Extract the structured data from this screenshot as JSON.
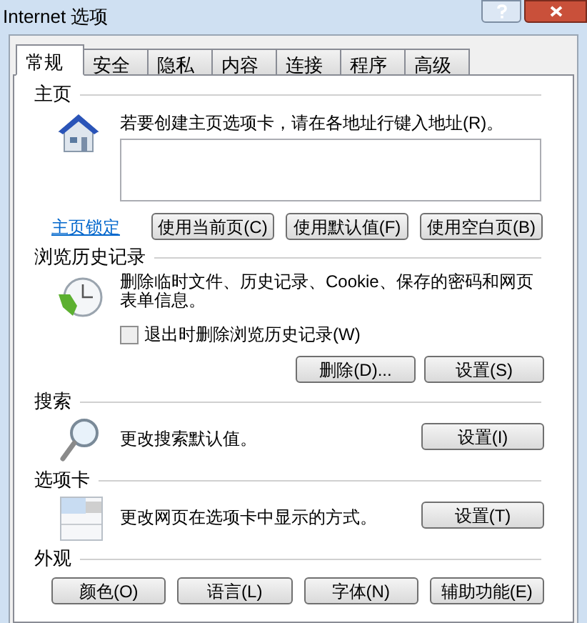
{
  "window": {
    "title": "Internet 选项"
  },
  "tabs": [
    {
      "label": "常规",
      "selected": true
    },
    {
      "label": "安全",
      "selected": false
    },
    {
      "label": "隐私",
      "selected": false
    },
    {
      "label": "内容",
      "selected": false
    },
    {
      "label": "连接",
      "selected": false
    },
    {
      "label": "程序",
      "selected": false
    },
    {
      "label": "高级",
      "selected": false
    }
  ],
  "sections": [
    {
      "kind": "home",
      "heading": "主页",
      "description": "若要创建主页选项卡，请在各地址行键入地址(R)。",
      "link": "主页锁定",
      "buttons": [
        "使用当前页(C)",
        "使用默认值(F)",
        "使用空白页(B)"
      ]
    },
    {
      "kind": "history",
      "heading": "浏览历史记录",
      "description": "删除临时文件、历史记录、Cookie、保存的密码和网页表单信息。",
      "checkbox": {
        "label": "退出时删除浏览历史记录(W)",
        "checked": false
      },
      "buttons": [
        "删除(D)...",
        "设置(S)"
      ]
    },
    {
      "kind": "search",
      "heading": "搜索",
      "description": "更改搜索默认值。",
      "buttons": [
        "设置(I)"
      ]
    },
    {
      "kind": "tabs",
      "heading": "选项卡",
      "description": "更改网页在选项卡中显示的方式。",
      "buttons": [
        "设置(T)"
      ]
    },
    {
      "kind": "appearance",
      "heading": "外观",
      "buttons": [
        "颜色(O)",
        "语言(L)",
        "字体(N)",
        "辅助功能(E)"
      ]
    }
  ]
}
